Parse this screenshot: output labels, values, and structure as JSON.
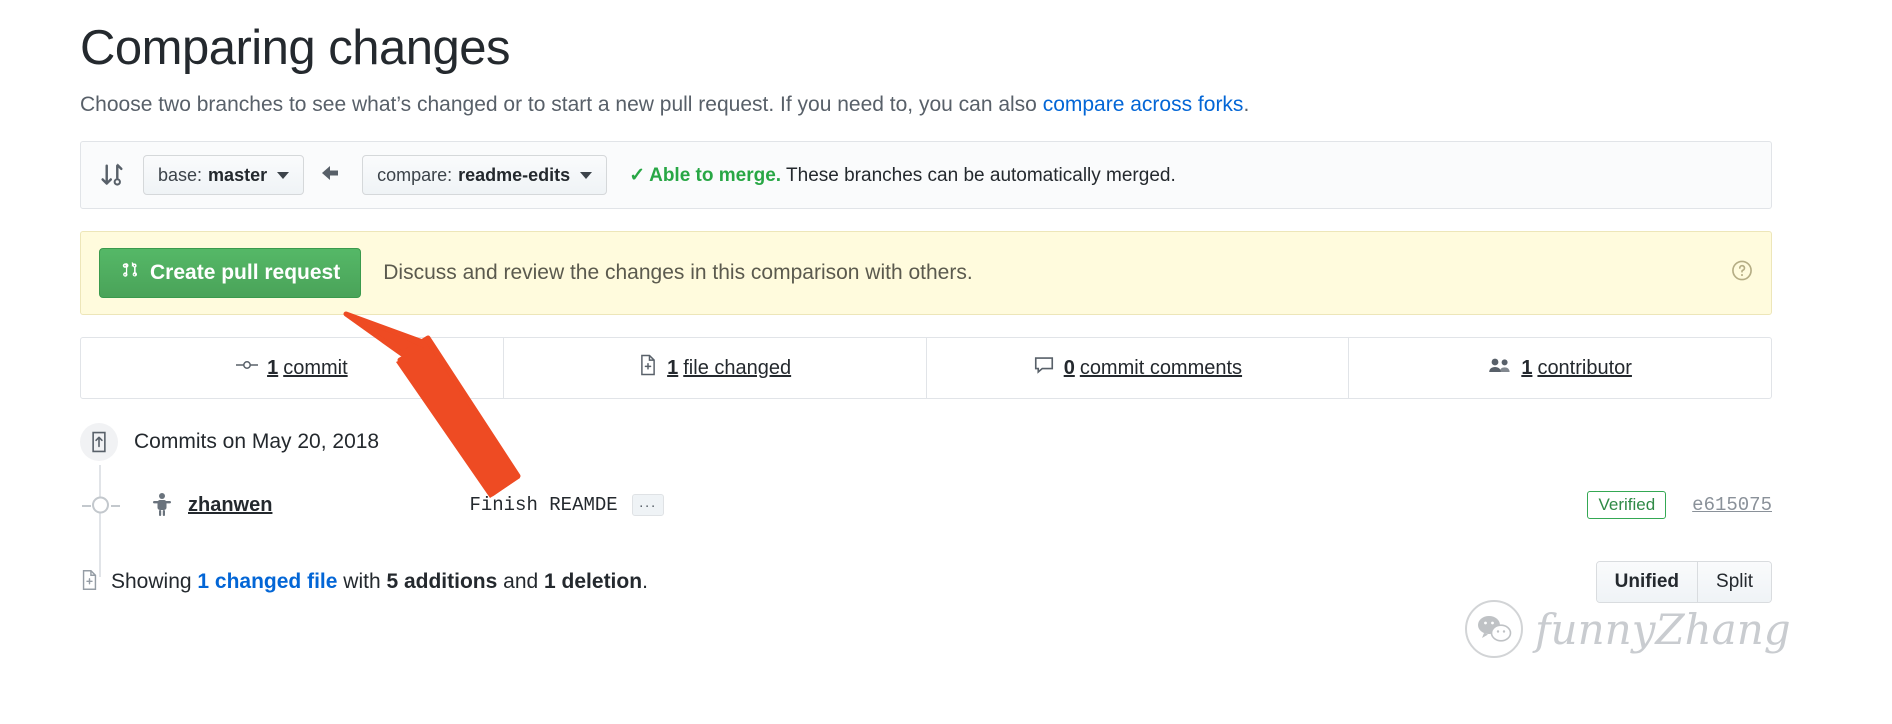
{
  "header": {
    "title": "Comparing changes",
    "subtitle_prefix": "Choose two branches to see what’s changed or to start a new pull request. If you need to, you can also ",
    "subtitle_link": "compare across forks",
    "subtitle_suffix": "."
  },
  "branch_bar": {
    "compare_icon": "compare-icon",
    "arrow_icon": "arrow-left-icon",
    "base": {
      "label": "base:",
      "value": "master",
      "caret": "chevron-down-icon"
    },
    "compare": {
      "label": "compare:",
      "value": "readme-edits",
      "caret": "chevron-down-icon"
    },
    "merge_check": "✓",
    "merge_status_bold": "Able to merge.",
    "merge_status_rest": " These branches can be automatically merged."
  },
  "pr_banner": {
    "button_label": "Create pull request",
    "button_icon": "git-pull-request-icon",
    "description": "Discuss and review the changes in this comparison with others.",
    "help_icon": "question-circle-icon",
    "button_color": "#4aa359",
    "background": "#fffbdd"
  },
  "stats": [
    {
      "icon": "commit-icon",
      "count": "1",
      "label": "commit"
    },
    {
      "icon": "file-diff-icon",
      "count": "1",
      "label": "file changed"
    },
    {
      "icon": "comment-icon",
      "count": "0",
      "label": "commit comments"
    },
    {
      "icon": "people-icon",
      "count": "1",
      "label": "contributor"
    }
  ],
  "commits": {
    "header_icon": "repo-push-icon",
    "date_header": "Commits on May 20, 2018",
    "row": {
      "avatar_icon": "user-avatar-icon",
      "author": "zhanwen",
      "message": "Finish REAMDE",
      "ellipsis_label": "···",
      "verified_badge": "Verified",
      "sha": "e615075"
    }
  },
  "footer": {
    "file_icon": "file-diff-icon",
    "showing_prefix": "Showing ",
    "changed_file_link": "1 changed file",
    "with_text": " with ",
    "additions": "5 additions",
    "and_text": " and ",
    "deletions": "1 deletion",
    "period": ".",
    "toggle": {
      "unified": "Unified",
      "split": "Split",
      "selected": "Unified"
    }
  },
  "watermark": {
    "logo_icon": "wechat-icon",
    "text": "funnyZhang"
  },
  "annotation": {
    "arrow_icon": "red-pointer-arrow-icon",
    "color": "#EE4B23"
  }
}
